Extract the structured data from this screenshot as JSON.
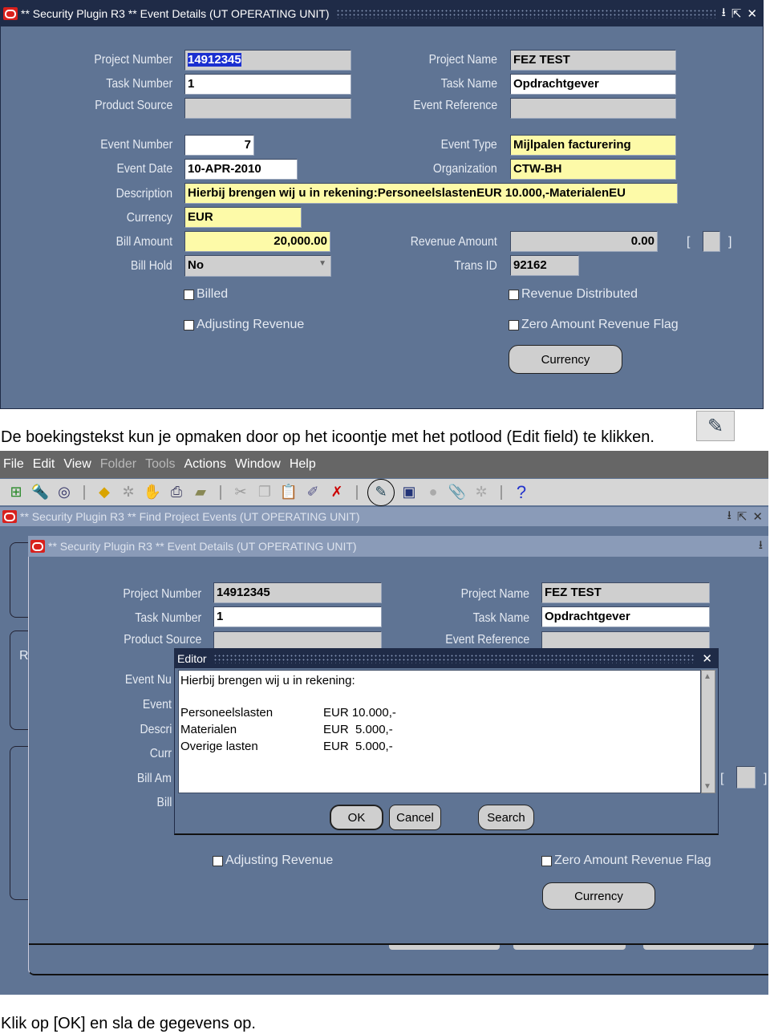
{
  "window1": {
    "title": "** Security Plugin R3 ** Event Details (UT OPERATING UNIT)",
    "fields": {
      "project_number": {
        "label": "Project Number",
        "value": "14912345"
      },
      "task_number": {
        "label": "Task Number",
        "value": "1"
      },
      "product_source": {
        "label": "Product Source",
        "value": ""
      },
      "project_name": {
        "label": "Project Name",
        "value": "FEZ TEST"
      },
      "task_name": {
        "label": "Task Name",
        "value": "Opdrachtgever"
      },
      "event_reference": {
        "label": "Event Reference",
        "value": ""
      },
      "event_number": {
        "label": "Event Number",
        "value": "7"
      },
      "event_date": {
        "label": "Event Date",
        "value": "10-APR-2010"
      },
      "description": {
        "label": "Description",
        "value": "Hierbij brengen wij u in rekening:PersoneelslastenEUR 10.000,-MaterialenEU"
      },
      "currency": {
        "label": "Currency",
        "value": "EUR"
      },
      "bill_amount": {
        "label": "Bill Amount",
        "value": "20,000.00"
      },
      "bill_hold": {
        "label": "Bill Hold",
        "value": "No"
      },
      "event_type": {
        "label": "Event Type",
        "value": "Mijlpalen facturering"
      },
      "organization": {
        "label": "Organization",
        "value": "CTW-BH"
      },
      "revenue_amount": {
        "label": "Revenue Amount",
        "value": "0.00"
      },
      "trans_id": {
        "label": "Trans ID",
        "value": "92162"
      }
    },
    "bracket_open": "[",
    "bracket_close": "]",
    "checkboxes": {
      "billed": "Billed",
      "adjusting_revenue": "Adjusting Revenue",
      "revenue_distributed": "Revenue Distributed",
      "zero_amount": "Zero Amount Revenue Flag"
    },
    "currency_button": "Currency"
  },
  "caption1": "De boekingstekst kun je opmaken door op het icoontje met het potlood (Edit field) te klikken.",
  "window2": {
    "menu": [
      "File",
      "Edit",
      "View",
      "Folder",
      "Tools",
      "Actions",
      "Window",
      "Help"
    ],
    "find_title": "** Security Plugin R3 ** Find Project Events (UT OPERATING UNIT)",
    "details_title": "** Security Plugin R3 ** Event Details (UT OPERATING UNIT)",
    "fields": {
      "project_number": {
        "label": "Project Number",
        "value": "14912345"
      },
      "task_number": {
        "label": "Task Number",
        "value": "1"
      },
      "product_source": {
        "label": "Product Source"
      },
      "project_name": {
        "label": "Project Name",
        "value": "FEZ TEST"
      },
      "task_name": {
        "label": "Task Name",
        "value": "Opdrachtgever"
      },
      "event_reference": {
        "label": "Event Reference"
      }
    },
    "partial_labels": [
      "Event Nu",
      "Event",
      "Descri",
      "Curr",
      "Bill Am",
      "Bill"
    ],
    "left_partial": "R",
    "checkboxes": {
      "adjusting_revenue": "Adjusting Revenue",
      "zero_amount": "Zero Amount Revenue Flag"
    },
    "currency_button": "Currency",
    "editor": {
      "title": "Editor",
      "intro": "Hierbij brengen wij u in rekening:",
      "lines": [
        {
          "item": "Personeelslasten",
          "amount": "EUR 10.000,-"
        },
        {
          "item": "Materialen",
          "amount": "EUR  5.000,-"
        },
        {
          "item": "Overige lasten",
          "amount": "EUR  5.000,-"
        }
      ],
      "ok": "OK",
      "cancel": "Cancel",
      "search": "Search"
    }
  },
  "caption2": "Klik op [OK] en sla de gegevens op."
}
